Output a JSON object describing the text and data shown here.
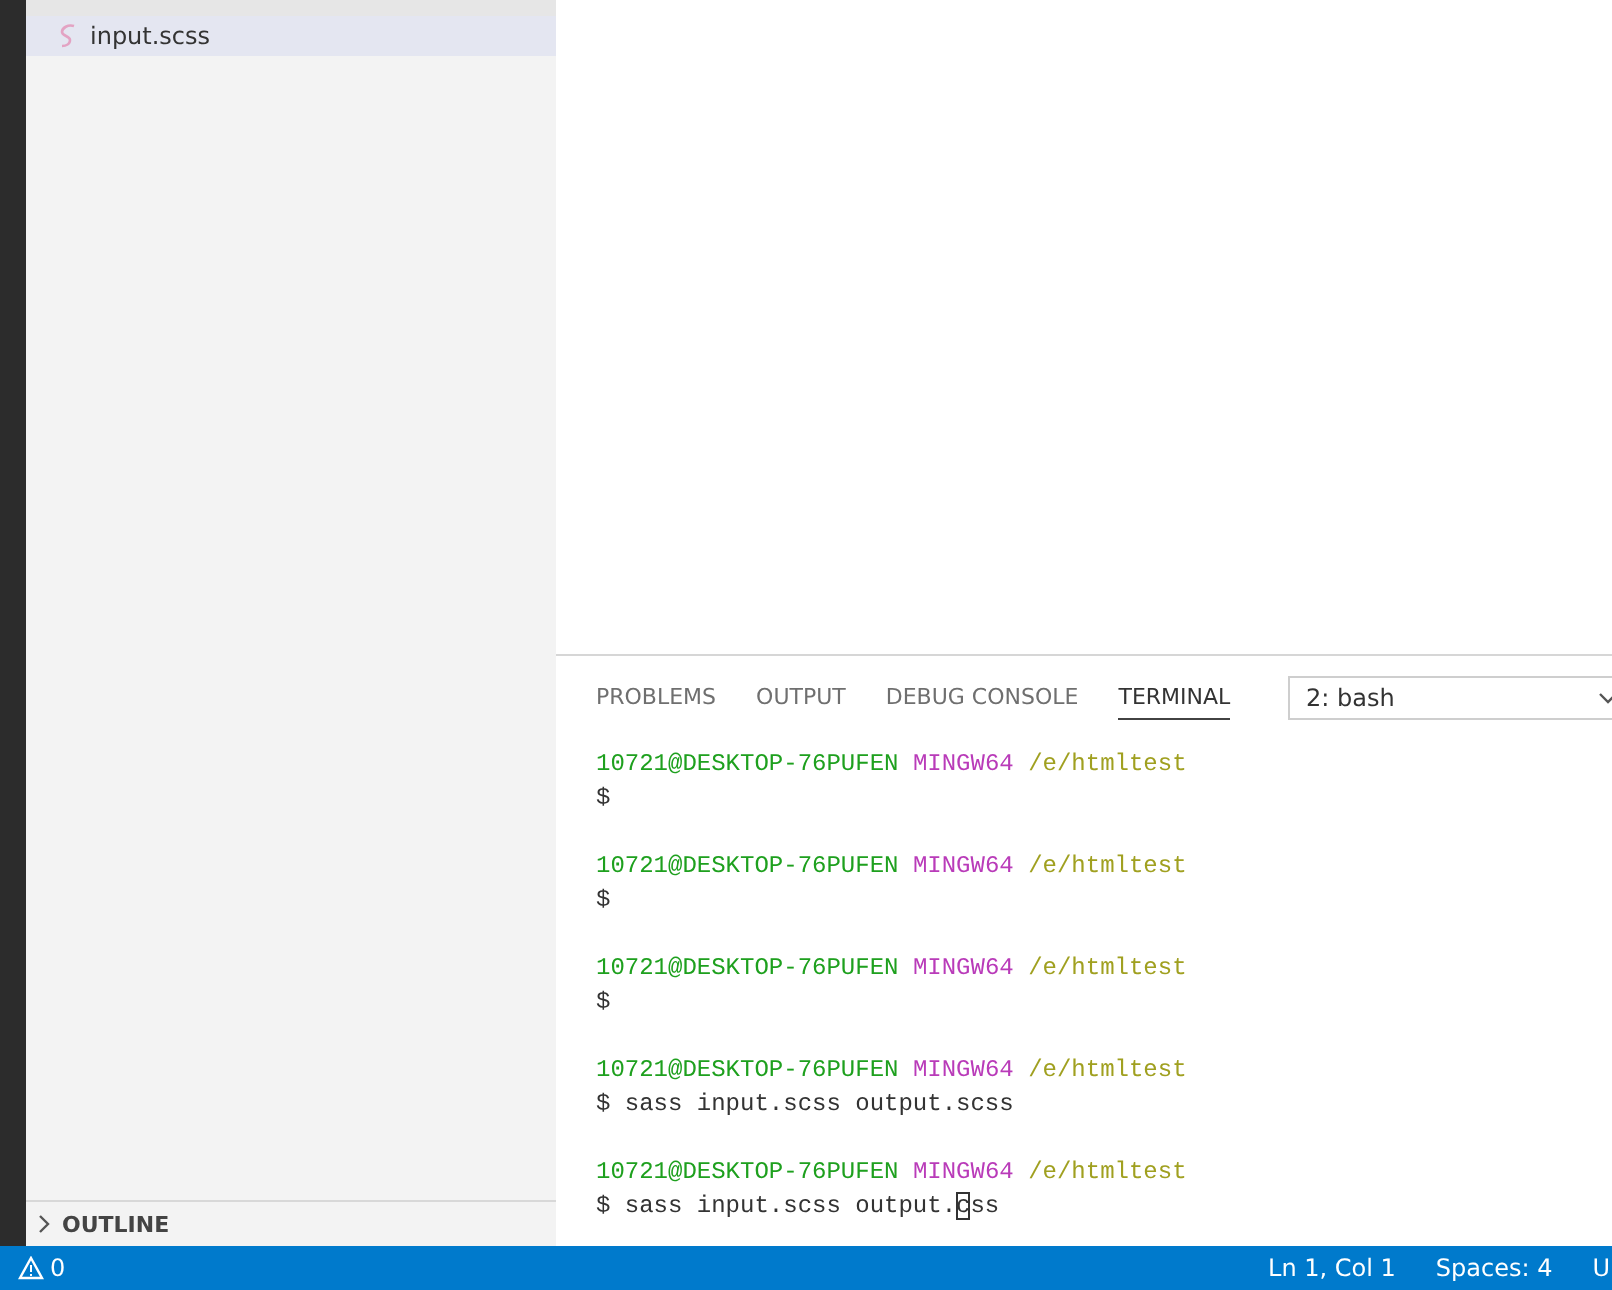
{
  "sidebar": {
    "files": [
      {
        "name": "input.scss",
        "selected": true
      }
    ],
    "sections": [
      {
        "title": "OUTLINE",
        "expanded": false
      }
    ]
  },
  "panel": {
    "tabs": [
      {
        "label": "PROBLEMS",
        "selected": false
      },
      {
        "label": "OUTPUT",
        "selected": false
      },
      {
        "label": "DEBUG CONSOLE",
        "selected": false
      },
      {
        "label": "TERMINAL",
        "selected": true
      }
    ],
    "terminal_select": {
      "value": "2: bash"
    },
    "terminal": [
      {
        "user": "10721@DESKTOP-76PUFEN",
        "host": "MINGW64",
        "path": "/e/htmltest",
        "command": "$"
      },
      {
        "user": "10721@DESKTOP-76PUFEN",
        "host": "MINGW64",
        "path": "/e/htmltest",
        "command": "$"
      },
      {
        "user": "10721@DESKTOP-76PUFEN",
        "host": "MINGW64",
        "path": "/e/htmltest",
        "command": "$"
      },
      {
        "user": "10721@DESKTOP-76PUFEN",
        "host": "MINGW64",
        "path": "/e/htmltest",
        "command": "$ sass input.scss output.scss"
      },
      {
        "user": "10721@DESKTOP-76PUFEN",
        "host": "MINGW64",
        "path": "/e/htmltest",
        "command": "$ sass input.scss output.",
        "cursor": "c",
        "after": "ss"
      }
    ]
  },
  "status_bar": {
    "left": [
      {
        "kind": "warning",
        "text": "0"
      }
    ],
    "right": [
      "Ln 1, Col 1",
      "Spaces: 4",
      "U"
    ]
  }
}
